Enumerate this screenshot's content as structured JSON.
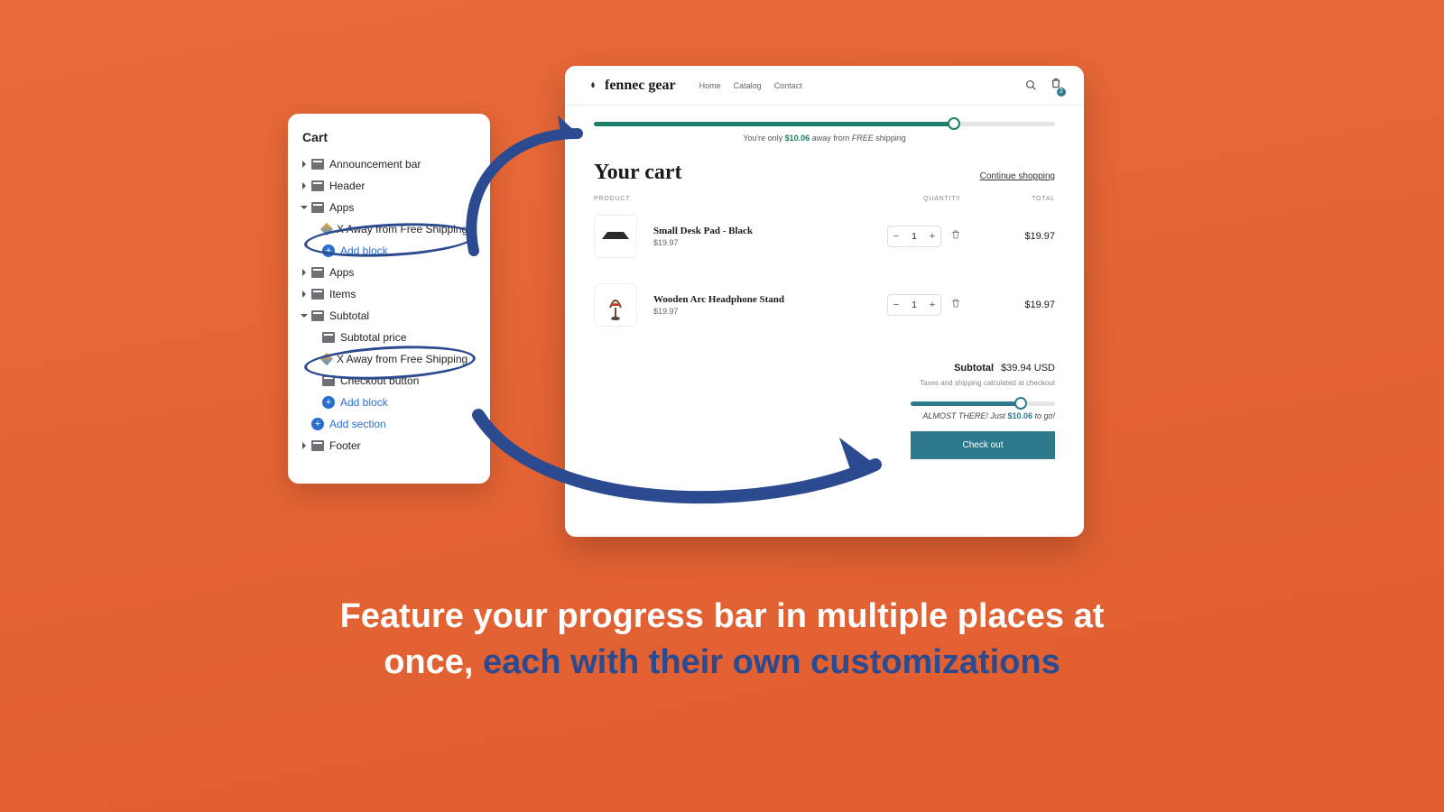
{
  "editor": {
    "title": "Cart",
    "items": [
      {
        "label": "Announcement bar",
        "depth": 0,
        "caret": true
      },
      {
        "label": "Header",
        "depth": 0,
        "caret": false
      },
      {
        "label": "Apps",
        "depth": 0,
        "caret": true,
        "open": true
      },
      {
        "label": "X Away from Free Shipping",
        "depth": 1,
        "block": true
      },
      {
        "label": "Add block",
        "depth": 1,
        "add": true
      },
      {
        "label": "Apps",
        "depth": 0,
        "caret": true
      },
      {
        "label": "Items",
        "depth": 0,
        "caret": false
      },
      {
        "label": "Subtotal",
        "depth": 0,
        "caret": true,
        "open": true
      },
      {
        "label": "Subtotal price",
        "depth": 1
      },
      {
        "label": "X Away from Free Shipping",
        "depth": 1,
        "block": true
      },
      {
        "label": "Checkout button",
        "depth": 1
      },
      {
        "label": "Add block",
        "depth": 1,
        "add": true
      },
      {
        "label": "Add section",
        "depth": 0,
        "add": true
      },
      {
        "label": "Footer",
        "depth": 0,
        "caret": true
      }
    ]
  },
  "preview": {
    "brand": "fennec gear",
    "nav": [
      "Home",
      "Catalog",
      "Contact"
    ],
    "cart_badge": 2,
    "progress_top": {
      "pct": 78,
      "color": "#1b8067",
      "msg_pre": "You're only ",
      "msg_amt": "$10.06",
      "msg_mid": " away from ",
      "msg_emph": "FREE",
      "msg_post": " shipping"
    },
    "heading": "Your cart",
    "continue": "Continue shopping",
    "columns": {
      "product": "PRODUCT",
      "qty": "QUANTITY",
      "total": "TOTAL"
    },
    "items": [
      {
        "name": "Small Desk Pad - Black",
        "price": "$19.97",
        "qty": 1,
        "total": "$19.97"
      },
      {
        "name": "Wooden Arc Headphone Stand",
        "price": "$19.97",
        "qty": 1,
        "total": "$19.97"
      }
    ],
    "subtotal_label": "Subtotal",
    "subtotal": "$39.94 USD",
    "tax_note": "Taxes and shipping calculated at checkout",
    "progress_bottom": {
      "pct": 76,
      "color": "#2d7a8c",
      "msg_pre": "ALMOST THERE!",
      "msg_mid": " Just ",
      "msg_amt": "$10.06",
      "msg_post": " to go!"
    },
    "checkout": "Check out"
  },
  "caption": {
    "line1": "Feature your progress bar in multiple places at",
    "line2a": "once",
    "line2b": ", ",
    "line2c": "each with their own customizations"
  }
}
